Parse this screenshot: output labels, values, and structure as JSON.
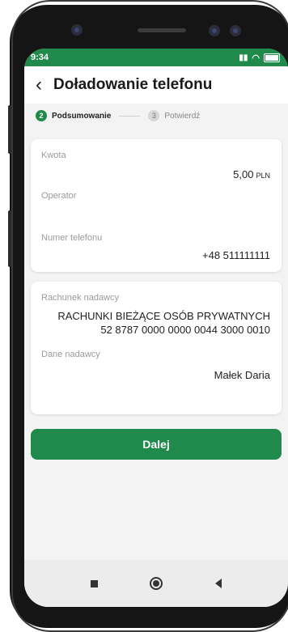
{
  "status": {
    "time": "9:34"
  },
  "header": {
    "back_icon": "‹",
    "title": "Doładowanie telefonu"
  },
  "steps": [
    {
      "number": "2",
      "label": "Podsumowanie",
      "active": true
    },
    {
      "number": "3",
      "label": "Potwierdź",
      "active": false
    }
  ],
  "summary": {
    "amount_label": "Kwota",
    "amount_value": "5,00",
    "amount_currency": "PLN",
    "operator_label": "Operator",
    "phone_label": "Numer telefonu",
    "phone_value": "+48 511111111"
  },
  "sender": {
    "account_label": "Rachunek nadawcy",
    "account_name": "RACHUNKI BIEŻĄCE OSÓB PRYWATNYCH",
    "account_number": "52 8787 0000 0000 0044 3000 0010",
    "sender_label": "Dane nadawcy",
    "sender_name": "Małek Daria"
  },
  "actions": {
    "next_label": "Dalej"
  },
  "colors": {
    "accent": "#1f8a4c"
  }
}
